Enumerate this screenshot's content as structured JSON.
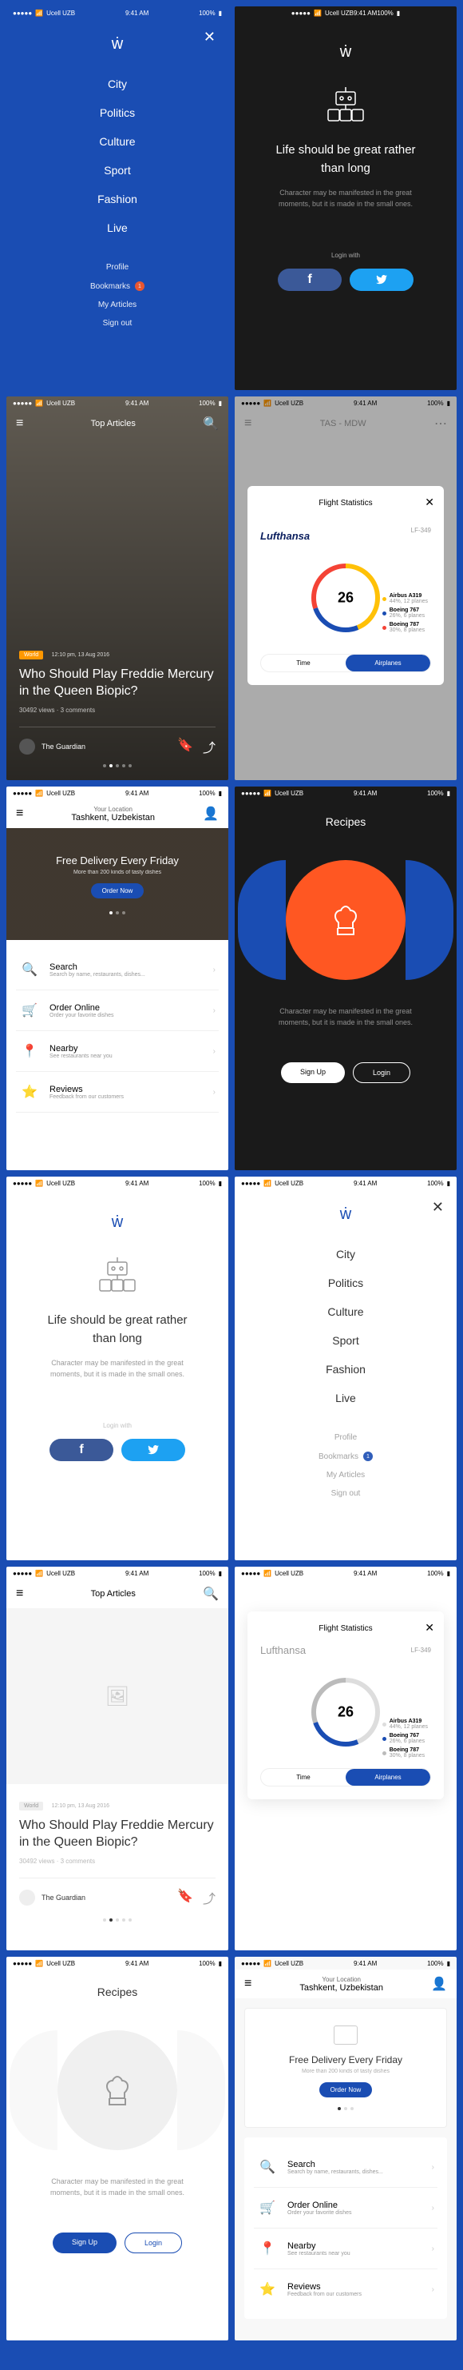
{
  "status": {
    "carrier": "Ucell UZB",
    "time": "9:41 AM",
    "battery": "100%"
  },
  "menu": {
    "items": [
      "City",
      "Politics",
      "Culture",
      "Sport",
      "Fashion",
      "Live"
    ],
    "secondary": [
      "Profile",
      "Bookmarks",
      "My Articles",
      "Sign out"
    ],
    "badge": "1"
  },
  "splash": {
    "title": "Life should be great rather than long",
    "subtitle": "Character may be manifested in the great moments, but it is made in the small ones.",
    "loginWith": "Login with"
  },
  "article": {
    "navTitle": "Top Articles",
    "tag": "World",
    "date": "12:10 pm, 13 Aug 2016",
    "title": "Who Should Play Freddie Mercury in the Queen Biopic?",
    "meta": "30492 views · 3 comments",
    "source": "The Guardian"
  },
  "flight": {
    "route": "TAS - MDW",
    "modalTitle": "Flight Statistics",
    "airline": "Lufthansa",
    "code": "LF-349",
    "count": "26",
    "planes": [
      {
        "name": "Airbus A319",
        "detail": "44%, 12 planes",
        "color": "#ffc107"
      },
      {
        "name": "Boeing 767",
        "detail": "26%, 6 planes",
        "color": "#1a4db3"
      },
      {
        "name": "Boeing 787",
        "detail": "30%, 8 planes",
        "color": "#f44336"
      }
    ],
    "pills": [
      "Time",
      "Airplanes"
    ]
  },
  "delivery": {
    "locLabel": "Your Location",
    "location": "Tashkent, Uzbekistan",
    "heroTitle": "Free Delivery Every Friday",
    "heroSub": "More than 200 kinds of tasty dishes",
    "orderBtn": "Order Now",
    "features": [
      {
        "title": "Search",
        "sub": "Search by name, restaurants, dishes..."
      },
      {
        "title": "Order Online",
        "sub": "Order your favorite dishes"
      },
      {
        "title": "Nearby",
        "sub": "See restaurants near you"
      },
      {
        "title": "Reviews",
        "sub": "Feedback from our customers"
      }
    ]
  },
  "recipes": {
    "title": "Recipes",
    "signup": "Sign Up",
    "login": "Login"
  }
}
